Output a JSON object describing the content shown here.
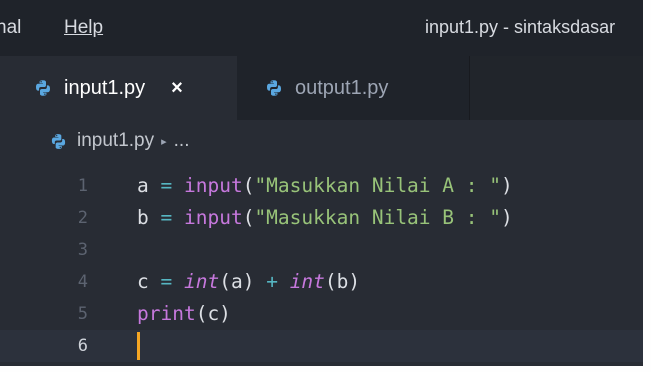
{
  "titlebar": {
    "menu_cut": "nal",
    "menu_help": "Help",
    "window_title": "input1.py - sintaksdasar"
  },
  "tabs": [
    {
      "label": "input1.py",
      "active": true,
      "close": "×",
      "icon": "python-icon"
    },
    {
      "label": "output1.py",
      "active": false,
      "icon": "python-icon"
    }
  ],
  "breadcrumb": {
    "file": "input1.py",
    "separator": "▸",
    "more": "..."
  },
  "editor": {
    "line_numbers": [
      "1",
      "2",
      "3",
      "4",
      "5",
      "6"
    ],
    "current_line": "6",
    "lines": [
      {
        "n": "1",
        "tokens": [
          {
            "t": "a",
            "k": "var"
          },
          {
            "t": " = ",
            "k": "op"
          },
          {
            "t": "input",
            "k": "fn"
          },
          {
            "t": "(",
            "k": "paren"
          },
          {
            "t": "\"Masukkan Nilai A : \"",
            "k": "str"
          },
          {
            "t": ")",
            "k": "paren"
          }
        ]
      },
      {
        "n": "2",
        "tokens": [
          {
            "t": "b",
            "k": "var"
          },
          {
            "t": " = ",
            "k": "op"
          },
          {
            "t": "input",
            "k": "fn"
          },
          {
            "t": "(",
            "k": "paren"
          },
          {
            "t": "\"Masukkan Nilai B : \"",
            "k": "str"
          },
          {
            "t": ")",
            "k": "paren"
          }
        ]
      },
      {
        "n": "3",
        "tokens": []
      },
      {
        "n": "4",
        "tokens": [
          {
            "t": "c",
            "k": "var"
          },
          {
            "t": " = ",
            "k": "op"
          },
          {
            "t": "int",
            "k": "builtin"
          },
          {
            "t": "(a)",
            "k": "paren"
          },
          {
            "t": " + ",
            "k": "op"
          },
          {
            "t": "int",
            "k": "builtin"
          },
          {
            "t": "(b)",
            "k": "paren"
          }
        ]
      },
      {
        "n": "5",
        "tokens": [
          {
            "t": "print",
            "k": "fn"
          },
          {
            "t": "(c)",
            "k": "paren"
          }
        ]
      },
      {
        "n": "6",
        "tokens": []
      }
    ]
  },
  "colors": {
    "editor_bg": "#282c34",
    "chrome_bg": "#1f232a",
    "keyword": "#c678dd",
    "string": "#98c379",
    "operator": "#56b6c2",
    "cursor": "#f5a623"
  }
}
